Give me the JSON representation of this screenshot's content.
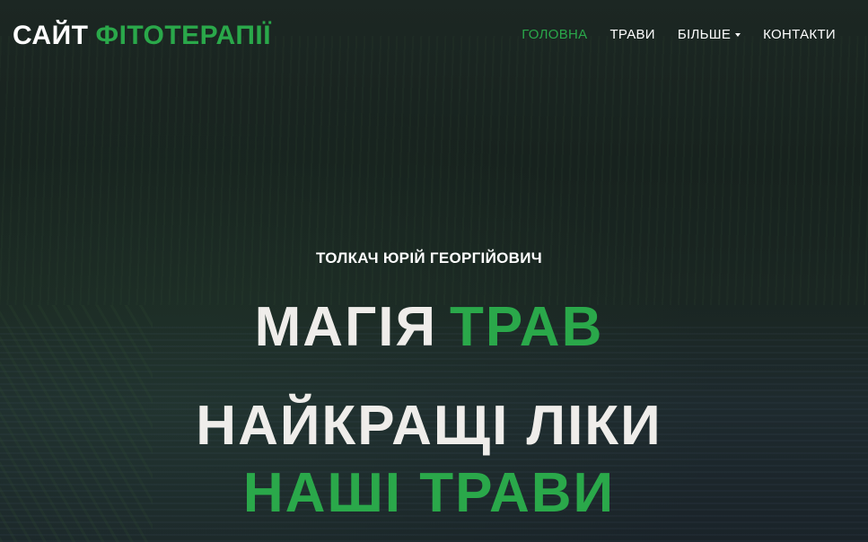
{
  "brand": {
    "part1": "САЙТ",
    "part2": "ФІТОТЕРАПІЇ"
  },
  "nav": {
    "items": [
      {
        "label": "ГОЛОВНА",
        "active": true
      },
      {
        "label": "ТРАВИ",
        "active": false
      },
      {
        "label": "БІЛЬШЕ",
        "active": false,
        "dropdown": true
      },
      {
        "label": "КОНТАКТИ",
        "active": false
      }
    ]
  },
  "hero": {
    "author": "ТОЛКАЧ ЮРІЙ ГЕОРГІЙОВИЧ",
    "headline1_white": "МАГІЯ",
    "headline1_green": "ТРАВ",
    "headline2": "НАЙКРАЩІ ЛІКИ",
    "headline3": "НАШІ ТРАВИ"
  },
  "colors": {
    "accent": "#2aa84a",
    "text_light": "#efedea",
    "background": "#1b2522"
  },
  "icons": {
    "dropdown": "caret-down-icon"
  }
}
